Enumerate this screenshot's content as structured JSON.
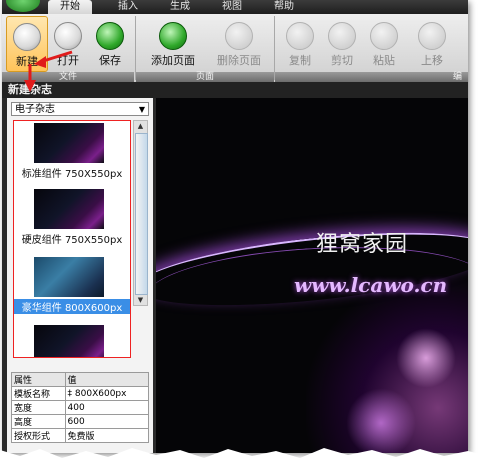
{
  "tabs": [
    "开始",
    "插入",
    "生成",
    "视图",
    "帮助"
  ],
  "ribbon": {
    "file_group": {
      "label": "文件",
      "buttons": [
        "新建",
        "打开",
        "保存"
      ]
    },
    "page_group": {
      "label": "页面",
      "buttons": [
        "添加页面",
        "删除页面"
      ]
    },
    "edit_buttons": [
      "复制",
      "剪切",
      "粘贴",
      "上移"
    ],
    "edit_group_label": "编"
  },
  "title": "新建杂志",
  "dropdown": {
    "value": "电子杂志"
  },
  "templates": [
    {
      "name": "标准组件 750X550px"
    },
    {
      "name": "硬皮组件 750X550px"
    },
    {
      "name": "豪华组件 800X600px",
      "selected": true
    },
    {
      "name": ""
    }
  ],
  "properties": {
    "header": [
      "属性",
      "值"
    ],
    "rows": [
      {
        "label": "模板名称",
        "value": "‡ 800X600px"
      },
      {
        "label": "宽度",
        "value": "400"
      },
      {
        "label": "高度",
        "value": "600"
      },
      {
        "label": "授权形式",
        "value": "免费版"
      }
    ]
  },
  "preview": {
    "brand": "狸窝家园",
    "url": "www.lcawo.cn"
  },
  "colors": {
    "highlight": "#ffc45a",
    "selection": "#3a8ee6",
    "annotation": "#e01b1b"
  }
}
